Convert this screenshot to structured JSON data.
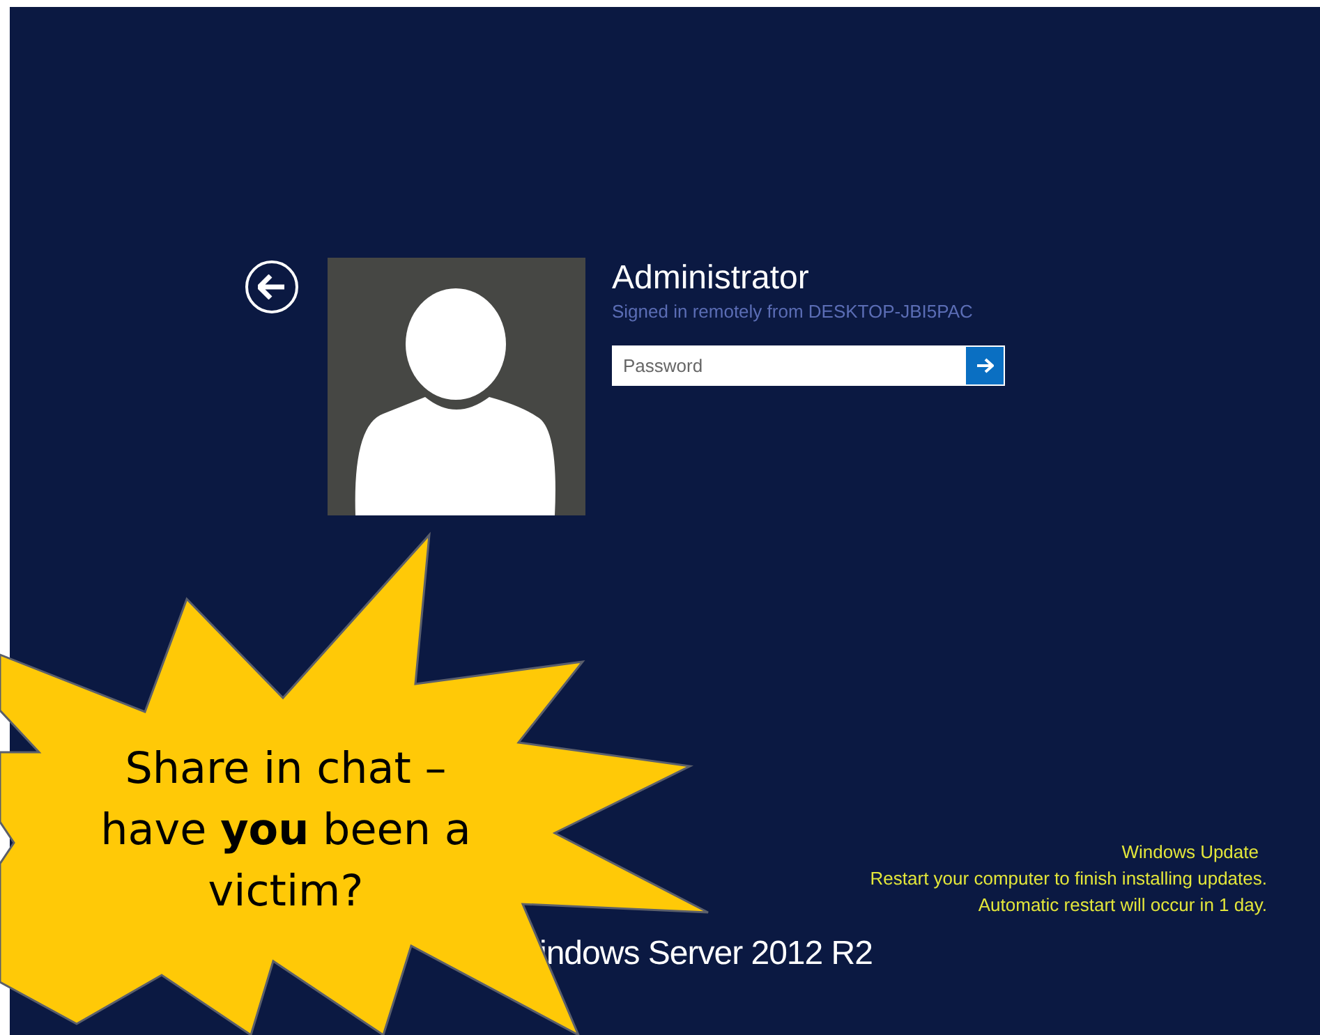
{
  "login": {
    "user_name": "Administrator",
    "remote_info": "Signed in remotely from DESKTOP-JBI5PAC",
    "password": {
      "placeholder": "Password"
    }
  },
  "update_notice": {
    "title": "Windows Update",
    "lines": [
      "Restart your computer to finish installing updates.",
      "Automatic restart will occur in 1 day."
    ]
  },
  "brand": "indows Server 2012 R2",
  "callout": {
    "text": "Share in chat –\nhave **you** been a\nvictim?"
  }
}
